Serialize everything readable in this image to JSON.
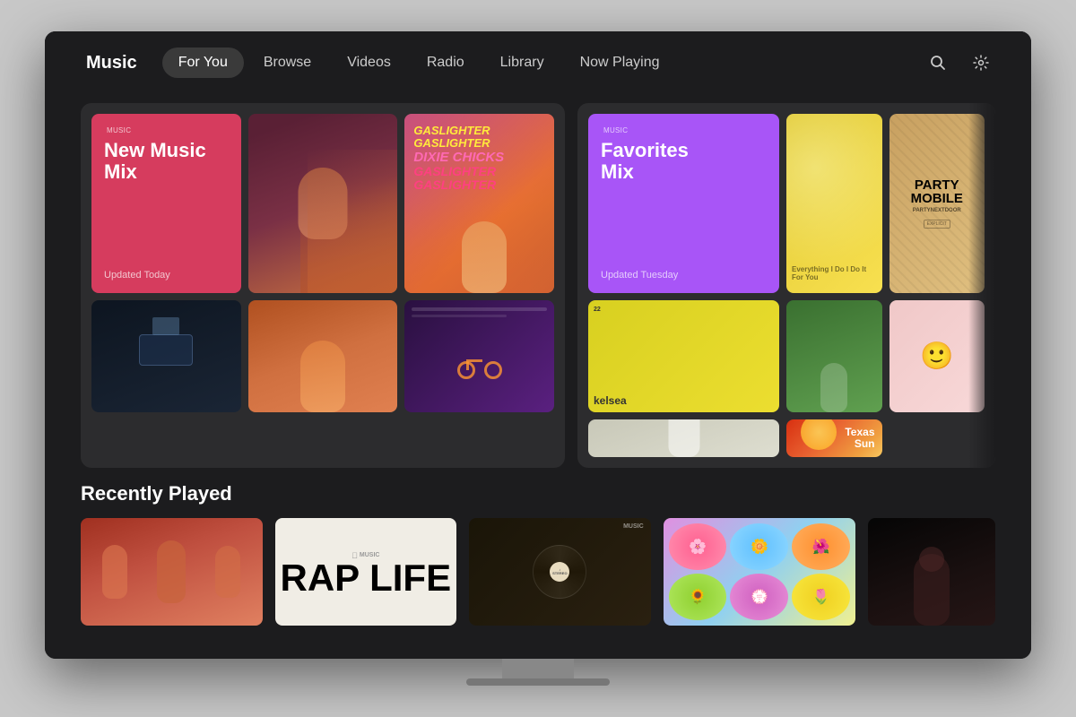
{
  "app": {
    "name": "Music",
    "logo_symbol": ""
  },
  "nav": {
    "items": [
      {
        "label": "For You",
        "active": true
      },
      {
        "label": "Browse",
        "active": false
      },
      {
        "label": "Videos",
        "active": false
      },
      {
        "label": "Radio",
        "active": false
      },
      {
        "label": "Library",
        "active": false
      },
      {
        "label": "Now Playing",
        "active": false
      }
    ],
    "search_label": "🔍",
    "settings_label": "⚙"
  },
  "featured": {
    "left_card": {
      "new_music_mix": {
        "badge": "MUSIC",
        "title": "New Music",
        "subtitle": "Mix",
        "updated": "Updated Today"
      },
      "gaslighter": {
        "lines": [
          "GASLIGHTER",
          "GASLIGHTER",
          "DIXIE CHICKS",
          "GASLIGHTER",
          "GASLIGHTER"
        ]
      }
    },
    "right_card": {
      "favorites_mix": {
        "badge": "MUSIC",
        "title": "Favorites",
        "subtitle": "Mix",
        "updated": "Updated Tuesday"
      },
      "partymobile": {
        "line1": "PARTY",
        "line2": "MOBILE",
        "artist": "PARTYNEXTDOOR"
      },
      "texas_sun": {
        "text": "Texas Sun"
      },
      "kelsea": {
        "label": "kelsea"
      }
    }
  },
  "recently_played": {
    "section_title": "Recently Played",
    "items": [
      {
        "type": "group_photo",
        "label": ""
      },
      {
        "type": "rap_life",
        "main_text": "RAP LIFE",
        "sub_text": ""
      },
      {
        "type": "vinyl",
        "label": "STEREO"
      },
      {
        "type": "flowers",
        "label": ""
      },
      {
        "type": "dark_figure",
        "label": ""
      }
    ]
  },
  "colors": {
    "bg": "#1c1c1e",
    "card_bg": "#2c2c2e",
    "new_music_red": "#d63c5e",
    "favorites_purple": "#a855f7",
    "text_primary": "#ffffff",
    "text_secondary": "#aaaaaa",
    "nav_active_bg": "#3a3a3a"
  }
}
